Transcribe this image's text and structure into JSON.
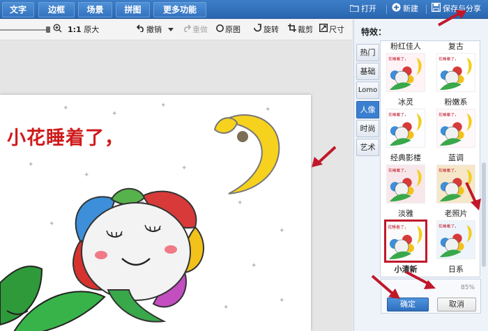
{
  "topbar": {
    "tabs": [
      "文字",
      "边框",
      "场景",
      "拼图"
    ],
    "more_label": "更多功能",
    "open_label": "打开",
    "new_label": "新建",
    "save_label": "保存与分享"
  },
  "toolbar": {
    "ratio_label": "1:1",
    "original_size_label": "原大",
    "undo_label": "撤销",
    "redo_label": "重做",
    "original_label": "原图",
    "rotate_label": "旋转",
    "crop_label": "裁剪",
    "size_label": "尺寸"
  },
  "photo": {
    "caption": "小花睡着了，"
  },
  "panel": {
    "title": "特效：",
    "categories": [
      "热门",
      "基础",
      "Lomo",
      "人像",
      "时尚",
      "艺术"
    ],
    "active_category": "人像",
    "effects": [
      "粉红佳人",
      "复古",
      "冰灵",
      "粉嫩系",
      "经典影楼",
      "蓝调",
      "淡雅",
      "老照片",
      "小清新",
      "日系"
    ],
    "selected_effect": "小清新",
    "thumb_caption": "花睡着了，",
    "strength": "85%",
    "ok_label": "确定",
    "cancel_label": "取消"
  },
  "colors": {
    "accent": "#2a66b0",
    "selection": "#c0182a",
    "annotation_arrow": "#c0182a"
  }
}
